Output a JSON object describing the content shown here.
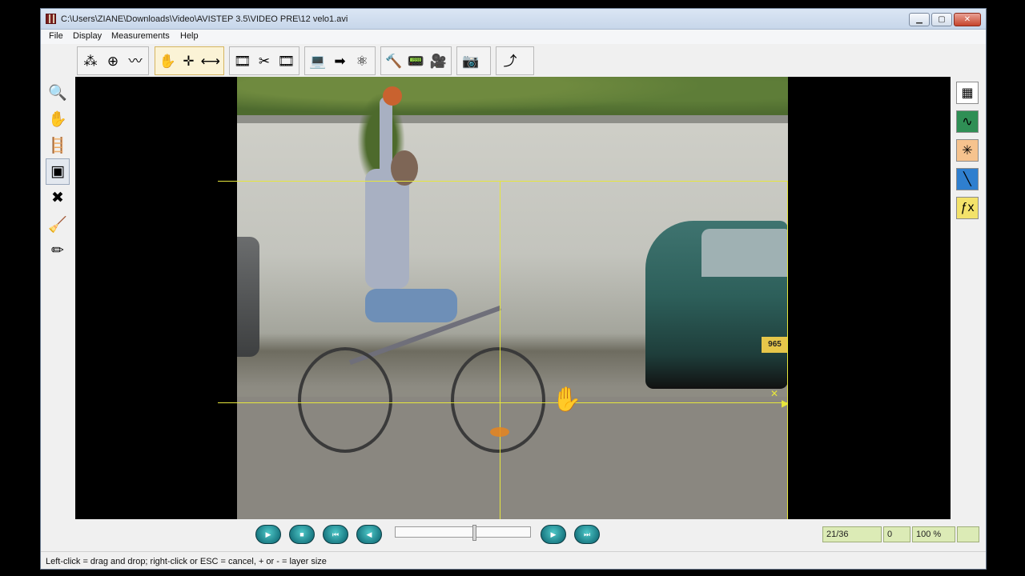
{
  "window": {
    "title": "C:\\Users\\ZIANE\\Downloads\\Video\\AVISTEP 3.5\\VIDEO PRE\\12 velo1.avi",
    "minimize_symbol": "▁",
    "maximize_symbol": "▢",
    "close_symbol": "✕"
  },
  "menu": [
    "File",
    "Display",
    "Measurements",
    "Help"
  ],
  "toolbar_groups": [
    {
      "name": "group-points",
      "icons": [
        "scatter-points-icon",
        "target-icon",
        "measuring-tape-icon"
      ],
      "glyphs": [
        "⁂",
        "⊕",
        "〰"
      ],
      "active": false
    },
    {
      "name": "group-origin",
      "icons": [
        "hand-icon",
        "axes-icon",
        "scale-bar-icon"
      ],
      "glyphs": [
        "✋",
        "✛",
        "⟷"
      ],
      "active": true
    },
    {
      "name": "group-edit",
      "icons": [
        "film-strip-icon",
        "scissors-icon",
        "film-join-icon"
      ],
      "glyphs": [
        "🎞",
        "✂",
        "🎞"
      ],
      "active": false
    },
    {
      "name": "group-export",
      "icons": [
        "computer-icon",
        "arrow-right-icon",
        "molecules-icon"
      ],
      "glyphs": [
        "💻",
        "➡",
        "⚛"
      ],
      "active": false
    },
    {
      "name": "group-tools",
      "icons": [
        "hammer-icon",
        "device-icon",
        "camera-tripod-icon"
      ],
      "glyphs": [
        "🔨",
        "📟",
        "🎥"
      ],
      "active": false
    },
    {
      "name": "group-capture",
      "icons": [
        "photo-camera-icon"
      ],
      "glyphs": [
        "📷"
      ],
      "active": false
    },
    {
      "name": "group-trajectory",
      "icons": [
        "trajectory-icon"
      ],
      "glyphs": [
        "⤴"
      ],
      "active": false
    }
  ],
  "left_tools": [
    {
      "name": "zoom-icon",
      "glyph": "🔍",
      "active": false
    },
    {
      "name": "hand-tool-icon",
      "glyph": "✋",
      "active": false
    },
    {
      "name": "ruler-ladder-icon",
      "glyph": "🪜",
      "active": false
    },
    {
      "name": "layer-icon",
      "glyph": "▣",
      "active": true
    },
    {
      "name": "delete-point-icon",
      "glyph": "✖",
      "active": false
    },
    {
      "name": "eraser-icon",
      "glyph": "🧹",
      "active": false
    },
    {
      "name": "pencil-icon",
      "glyph": "✏",
      "active": false
    }
  ],
  "right_tools": [
    {
      "name": "table-icon",
      "glyph": "▦",
      "color": "#ffffff"
    },
    {
      "name": "curve-icon",
      "glyph": "∿",
      "color": "#2f8f55"
    },
    {
      "name": "intersection-icon",
      "glyph": "✳",
      "color": "#f6c38e"
    },
    {
      "name": "line-icon",
      "glyph": "╲",
      "color": "#2f7fcf"
    },
    {
      "name": "function-icon",
      "glyph": "ƒx",
      "color": "#f3e26a"
    }
  ],
  "video": {
    "plate_text": "965"
  },
  "playback": {
    "buttons": [
      {
        "name": "play-button",
        "glyph": "▶"
      },
      {
        "name": "stop-button",
        "glyph": "■"
      },
      {
        "name": "first-frame-button",
        "glyph": "⏮"
      },
      {
        "name": "prev-frame-button",
        "glyph": "◀"
      },
      {
        "name": "next-frame-button",
        "glyph": "▶"
      },
      {
        "name": "last-frame-button",
        "glyph": "⏭"
      }
    ],
    "slider_position": 0.58,
    "frame_counter": "21/36",
    "value": "0",
    "zoom": "100 %",
    "extra": ""
  },
  "status": {
    "hint": "Left-click = drag and drop; right-click or ESC = cancel, + or - = layer size"
  }
}
